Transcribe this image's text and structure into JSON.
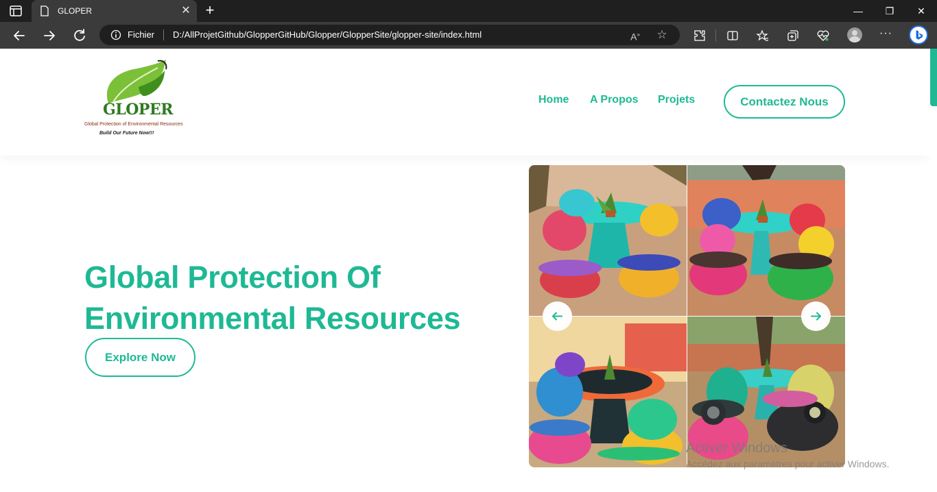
{
  "browser": {
    "tab_title": "GLOPER",
    "address_label": "Fichier",
    "url": "D:/AllProjetGithub/GlopperGitHub/Glopper/GlopperSite/glopper-site/index.html",
    "accent": "#1b6be0"
  },
  "site": {
    "brand_color": "#1eb994",
    "logo": {
      "name": "GLOPER",
      "tagline": "Global Protection of Environmental Resources",
      "slogan": "Build Our Future Now!!!"
    },
    "nav": [
      {
        "label": "Home"
      },
      {
        "label": "A Propos"
      },
      {
        "label": "Projets"
      }
    ],
    "contact_button": "Contactez Nous",
    "hero": {
      "title_line1": "Global Protection Of",
      "title_line2": "Environmental Resources",
      "cta": "Explore Now"
    },
    "carousel": {
      "images": [
        "tire-furniture-turquoise-table",
        "tire-furniture-colorful-chairs",
        "tire-furniture-black-table",
        "tire-furniture-car-tire-seats"
      ]
    }
  },
  "os_watermark": {
    "title": "Activer Windows",
    "subtitle": "Accédez aux paramètres pour activer Windows."
  }
}
